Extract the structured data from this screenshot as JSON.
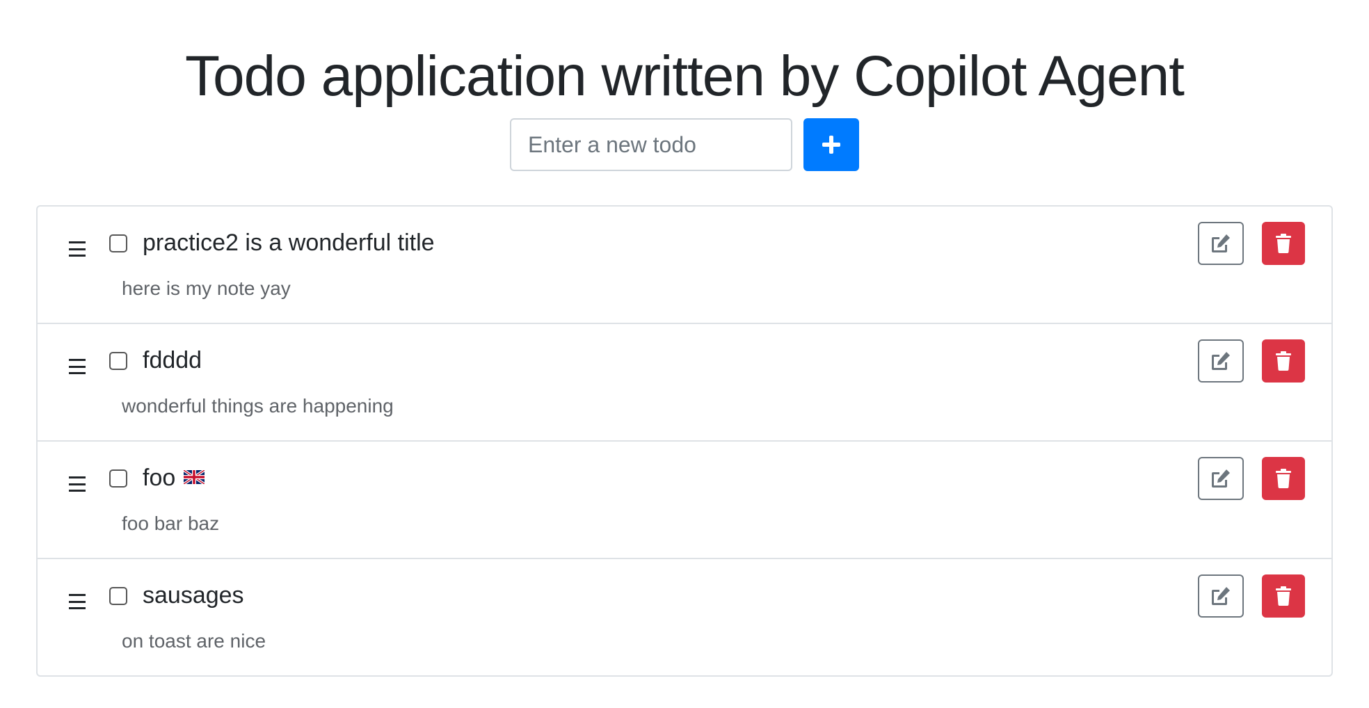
{
  "app": {
    "title": "Todo application written by Copilot Agent"
  },
  "add_form": {
    "placeholder": "Enter a new todo",
    "value": "",
    "add_icon": "plus-icon"
  },
  "todos": [
    {
      "title": "practice2 is a wonderful title",
      "note": "here is my note yay",
      "completed": false,
      "flag": null
    },
    {
      "title": "fdddd",
      "note": "wonderful things are happening",
      "completed": false,
      "flag": null
    },
    {
      "title": "foo",
      "note": "foo bar baz",
      "completed": false,
      "flag": "🇬🇧"
    },
    {
      "title": "sausages",
      "note": "on toast are nice",
      "completed": false,
      "flag": null
    }
  ],
  "icons": {
    "drag": "drag-handle-icon",
    "edit": "edit-icon",
    "delete": "trash-icon"
  },
  "colors": {
    "primary": "#007bff",
    "danger": "#dc3545",
    "secondary": "#6c757d",
    "border": "#dee2e6",
    "text": "#212529"
  }
}
